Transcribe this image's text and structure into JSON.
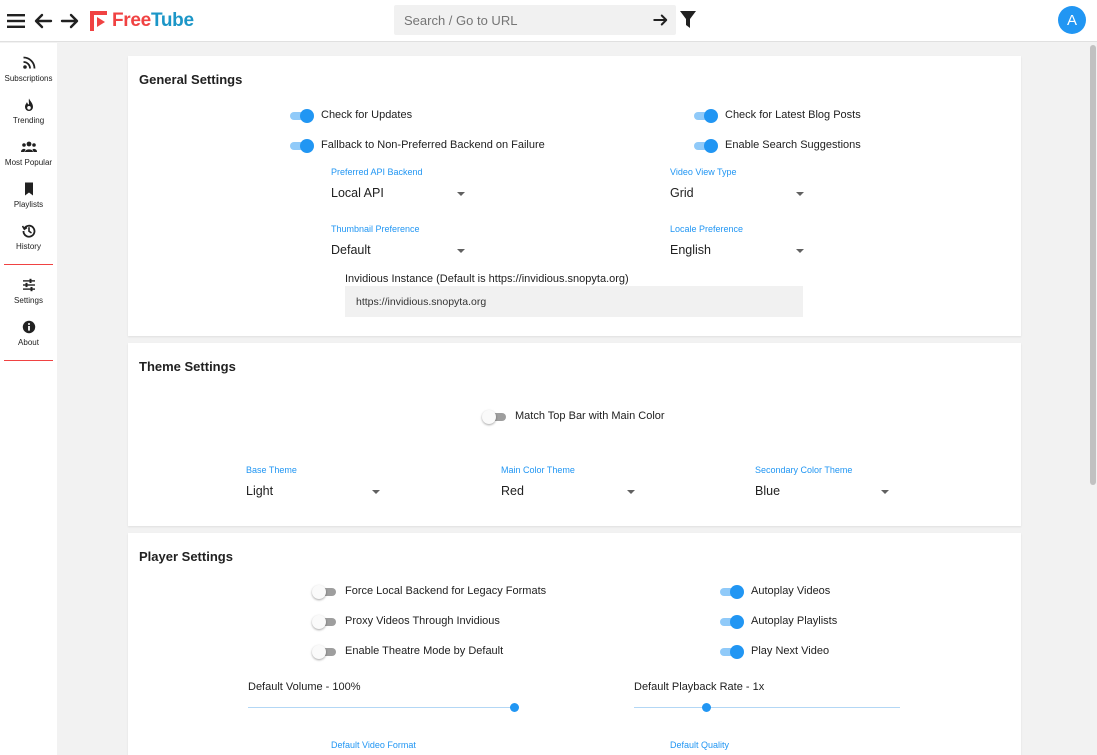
{
  "app": {
    "logo_free": "Free",
    "logo_tube": "Tube",
    "avatar_letter": "A",
    "accent_color": "#f04242",
    "brand_blue": "#1c96c7",
    "primary_color": "#2196f3"
  },
  "topbar": {
    "search_placeholder": "Search / Go to URL",
    "icons": [
      "menu-icon",
      "back-arrow-icon",
      "forward-arrow-icon",
      "search-go-icon",
      "filter-icon"
    ]
  },
  "sidebar": {
    "items": [
      {
        "label": "Subscriptions",
        "icon": "rss-icon"
      },
      {
        "label": "Trending",
        "icon": "fire-icon"
      },
      {
        "label": "Most Popular",
        "icon": "users-icon"
      },
      {
        "label": "Playlists",
        "icon": "bookmark-icon"
      },
      {
        "label": "History",
        "icon": "history-icon"
      },
      {
        "label": "Settings",
        "icon": "sliders-icon"
      },
      {
        "label": "About",
        "icon": "info-icon"
      }
    ]
  },
  "general": {
    "title": "General Settings",
    "toggles": [
      {
        "label": "Check for Updates",
        "on": true
      },
      {
        "label": "Check for Latest Blog Posts",
        "on": true
      },
      {
        "label": "Fallback to Non-Preferred Backend on Failure",
        "on": true
      },
      {
        "label": "Enable Search Suggestions",
        "on": true
      }
    ],
    "selects": [
      {
        "label": "Preferred API Backend",
        "value": "Local API"
      },
      {
        "label": "Video View Type",
        "value": "Grid"
      },
      {
        "label": "Thumbnail Preference",
        "value": "Default"
      },
      {
        "label": "Locale Preference",
        "value": "English"
      }
    ],
    "invidious_label": "Invidious Instance (Default is https://invidious.snopyta.org)",
    "invidious_value": "https://invidious.snopyta.org"
  },
  "theme": {
    "title": "Theme Settings",
    "toggle": {
      "label": "Match Top Bar with Main Color",
      "on": false
    },
    "selects": [
      {
        "label": "Base Theme",
        "value": "Light"
      },
      {
        "label": "Main Color Theme",
        "value": "Red"
      },
      {
        "label": "Secondary Color Theme",
        "value": "Blue"
      }
    ]
  },
  "player": {
    "title": "Player Settings",
    "toggles": [
      {
        "label": "Force Local Backend for Legacy Formats",
        "on": false
      },
      {
        "label": "Autoplay Videos",
        "on": true
      },
      {
        "label": "Proxy Videos Through Invidious",
        "on": false
      },
      {
        "label": "Autoplay Playlists",
        "on": true
      },
      {
        "label": "Enable Theatre Mode by Default",
        "on": false
      },
      {
        "label": "Play Next Video",
        "on": true
      }
    ],
    "volume_label": "Default Volume - 100%",
    "volume_fraction": 1.0,
    "rate_label": "Default Playback Rate - 1x",
    "rate_fraction": 0.27,
    "selects": [
      {
        "label": "Default Video Format"
      },
      {
        "label": "Default Quality"
      }
    ]
  }
}
